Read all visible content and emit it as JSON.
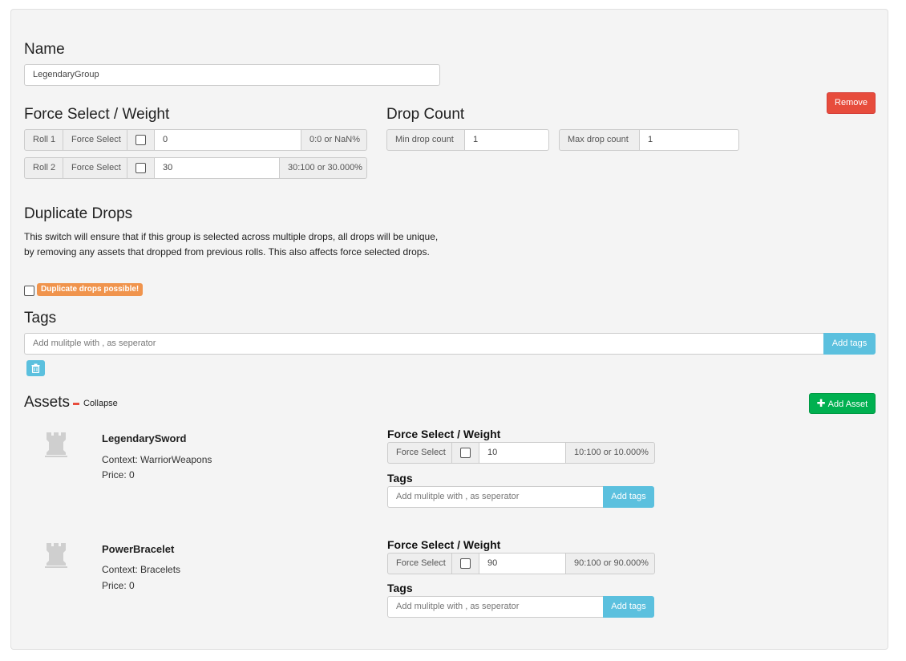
{
  "name_section": {
    "heading": "Name",
    "value": "LegendaryGroup"
  },
  "remove_label": "Remove",
  "force_select": {
    "heading": "Force Select / Weight",
    "rows": [
      {
        "roll": "Roll 1",
        "force_label": "Force Select",
        "weight": "0",
        "ratio": "0:0 or NaN%"
      },
      {
        "roll": "Roll 2",
        "force_label": "Force Select",
        "weight": "30",
        "ratio": "30:100 or 30.000%"
      }
    ]
  },
  "drop_count": {
    "heading": "Drop Count",
    "min_label": "Min drop count",
    "min_value": "1",
    "max_label": "Max drop count",
    "max_value": "1"
  },
  "duplicate": {
    "heading": "Duplicate Drops",
    "description": "This switch will ensure that if this group is selected across multiple drops, all drops will be unique, by removing any assets that dropped from previous rolls. This also affects force selected drops.",
    "badge": "Duplicate drops possible!"
  },
  "tags": {
    "heading": "Tags",
    "placeholder": "Add mulitple with , as seperator",
    "button": "Add tags"
  },
  "assets": {
    "heading": "Assets",
    "collapse": "Collapse",
    "add_label": "Add Asset",
    "items": [
      {
        "name": "LegendarySword",
        "context": "Context: WarriorWeapons",
        "price": "Price: 0",
        "fs_heading": "Force Select / Weight",
        "force_label": "Force Select",
        "weight": "10",
        "ratio": "10:100 or 10.000%",
        "tags_heading": "Tags",
        "tags_placeholder": "Add mulitple with , as seperator",
        "tags_button": "Add tags"
      },
      {
        "name": "PowerBracelet",
        "context": "Context: Bracelets",
        "price": "Price: 0",
        "fs_heading": "Force Select / Weight",
        "force_label": "Force Select",
        "weight": "90",
        "ratio": "90:100 or 90.000%",
        "tags_heading": "Tags",
        "tags_placeholder": "Add mulitple with , as seperator",
        "tags_button": "Add tags"
      }
    ]
  },
  "colors": {
    "remove": "#e74c3c",
    "add_asset": "#00b050",
    "badge": "#f0944d",
    "info": "#5bc0de"
  },
  "icons": {
    "trash": "trash-icon",
    "plus": "plus-icon",
    "minus": "minus-icon",
    "asset": "castle-rook-icon"
  }
}
